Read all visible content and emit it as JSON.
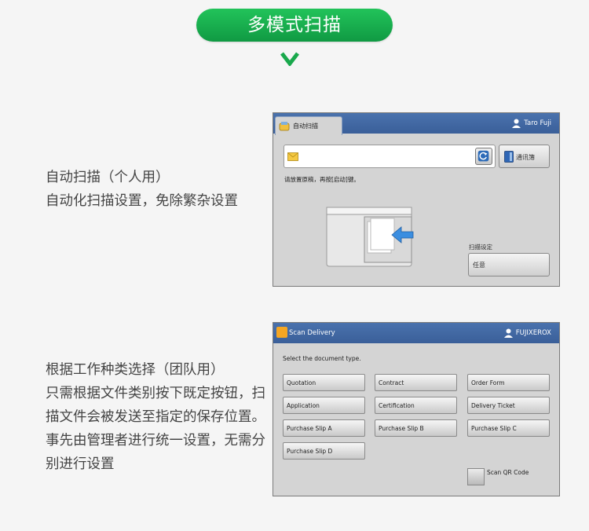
{
  "header": {
    "title": "多模式扫描"
  },
  "section1": {
    "heading": "自动扫描（个人用）",
    "body": "自动化扫描设置，免除繁杂设置"
  },
  "section2": {
    "heading": "根据工作种类选择（团队用）",
    "body": "只需根据文件类别按下既定按钮，扫描文件会被发送至指定的保存位置。事先由管理者进行统一设置，无需分别进行设置"
  },
  "screen1": {
    "tab_label": "自动扫描",
    "user": "Taro Fuji",
    "address_button": "通讯簿",
    "message": "请放置原稿，再按[启动]键。",
    "settings_label": "扫描设定",
    "settings_value": "任意"
  },
  "screen2": {
    "title": "Scan Delivery",
    "user": "FUJIXEROX",
    "instruction": "Select the document type.",
    "buttons": [
      "Quotation",
      "Contract",
      "Order Form",
      "Application",
      "Certification",
      "Delivery Ticket",
      "Purchase Slip A",
      "Purchase Slip B",
      "Purchase Slip C",
      "Purchase Slip D"
    ],
    "qr_label": "Scan QR Code"
  },
  "colors": {
    "accent_green": "#1aab4f",
    "titlebar_blue": "#4169a8"
  },
  "icons": [
    "chevron-down-icon",
    "scan-app-icon",
    "user-icon",
    "mail-icon",
    "refresh-icon",
    "address-book-icon",
    "scanner-illustration",
    "scan-delivery-icon"
  ]
}
